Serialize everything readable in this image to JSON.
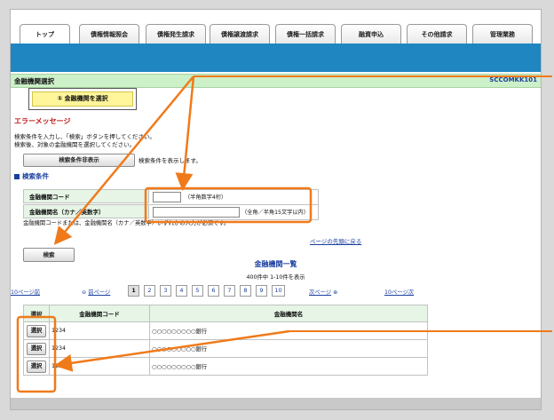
{
  "tabs": [
    "トップ",
    "債権情報照会",
    "債権発生請求",
    "債権譲渡請求",
    "債権一括請求",
    "融資申込",
    "その他請求",
    "管理業務"
  ],
  "page": {
    "title": "金融機関選択",
    "screen_code": "SCCOMKK101",
    "step_label": "① 金融機関を選択"
  },
  "error": {
    "heading": "エラーメッセージ",
    "line1": "検索条件を入力し、「検索」ボタンを押してください。",
    "line2": "検索後、対象の金融機関を選択してください。"
  },
  "toggle": {
    "button_label": "検索条件非表示",
    "note": "検索条件を表示します。"
  },
  "search": {
    "section_title": "検索条件",
    "code_label": "金融機関コード",
    "code_hint": "（半角数字4桁）",
    "name_label": "金融機関名（カナ／英数字）",
    "name_hint": "（全角／半角15文字以内）",
    "required_note": "金融機関コードまたは、金融機関名（カナ／英数字）いずれかの入力が必須です。",
    "back_to_top": "ページの先頭に戻る",
    "search_button": "検索"
  },
  "list": {
    "title": "金融機関一覧",
    "count": "400件中 1-10件を表示",
    "prev10": "10ページ前",
    "prev": "前ページ",
    "next": "次ページ",
    "next10": "10ページ次",
    "pages": [
      "1",
      "2",
      "3",
      "4",
      "5",
      "6",
      "7",
      "8",
      "9",
      "10"
    ],
    "current_page": "1",
    "columns": [
      "選択",
      "金融機関コード",
      "金融機関名"
    ],
    "rows": [
      {
        "select": "選択",
        "code": "1234",
        "name": "○○○○○○○○○銀行"
      },
      {
        "select": "選択",
        "code": "1234",
        "name": "○○○○○○○○○銀行"
      },
      {
        "select": "選択",
        "code": "1234",
        "name": "○○○○○○○○○銀行"
      }
    ]
  },
  "colors": {
    "band": "#1f86c1",
    "title_green": "#ccf0c8",
    "callout": "#f07a1a",
    "error_red": "#c01818",
    "link_blue": "#1a3fa0"
  }
}
